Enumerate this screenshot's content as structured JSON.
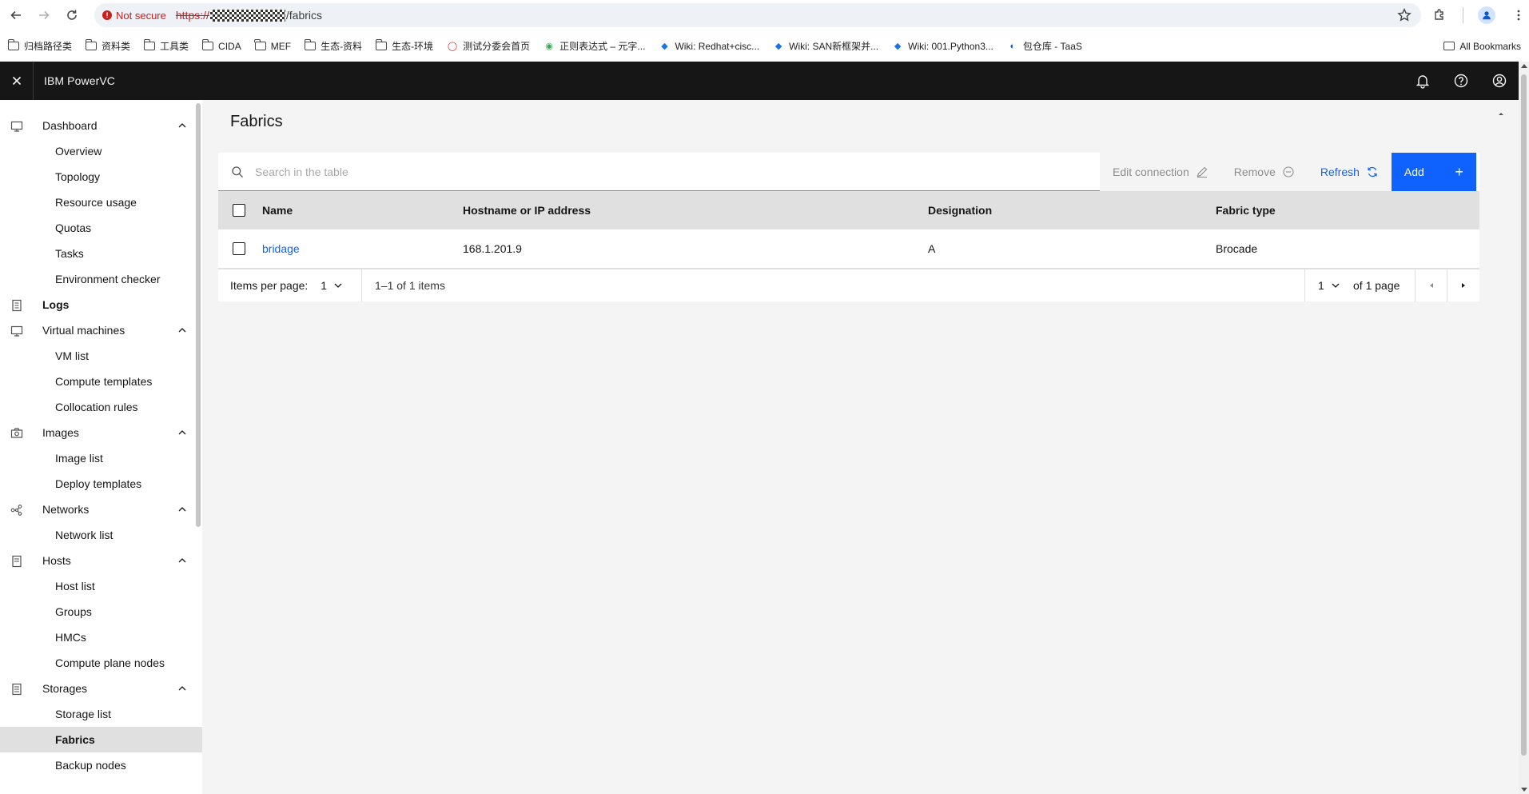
{
  "browser": {
    "security_label": "Not secure",
    "url_scheme": "https://",
    "url_path": "/fabrics",
    "bookmarks": [
      "归档路径类",
      "资料类",
      "工具类",
      "CIDA",
      "MEF",
      "生态-资料",
      "生态-环境",
      "测试分委会首页",
      "正则表达式 – 元字...",
      "Wiki: Redhat+cisc...",
      "Wiki: SAN新框架并...",
      "Wiki: 001.Python3...",
      "包仓库 - TaaS"
    ],
    "all_bookmarks": "All Bookmarks"
  },
  "app": {
    "brand": "IBM PowerVC"
  },
  "sidebar": {
    "dashboard": "Dashboard",
    "overview": "Overview",
    "topology": "Topology",
    "resource_usage": "Resource usage",
    "quotas": "Quotas",
    "tasks": "Tasks",
    "environment_checker": "Environment checker",
    "logs": "Logs",
    "virtual_machines": "Virtual machines",
    "vm_list": "VM list",
    "compute_templates": "Compute templates",
    "collocation_rules": "Collocation rules",
    "images": "Images",
    "image_list": "Image list",
    "deploy_templates": "Deploy templates",
    "networks": "Networks",
    "network_list": "Network list",
    "hosts": "Hosts",
    "host_list": "Host list",
    "groups": "Groups",
    "hmcs": "HMCs",
    "compute_plane_nodes": "Compute plane nodes",
    "storages": "Storages",
    "storage_list": "Storage list",
    "fabrics": "Fabrics",
    "backup_nodes": "Backup nodes"
  },
  "main": {
    "title": "Fabrics",
    "search_placeholder": "Search in the table",
    "edit_connection": "Edit connection",
    "remove": "Remove",
    "refresh": "Refresh",
    "add": "Add",
    "columns": {
      "name": "Name",
      "host": "Hostname or IP address",
      "designation": "Designation",
      "type": "Fabric type"
    },
    "rows": [
      {
        "name": "bridage",
        "host": "168.1.201.9",
        "designation": "A",
        "type": "Brocade"
      }
    ],
    "pagination": {
      "items_per_page_label": "Items per page:",
      "items_per_page_value": "1",
      "range": "1–1 of 1 items",
      "page_value": "1",
      "of_pages": "of 1 page"
    }
  },
  "colors": {
    "header_bg": "#161616",
    "primary": "#0f62fe",
    "content_bg": "#f4f4f4"
  }
}
